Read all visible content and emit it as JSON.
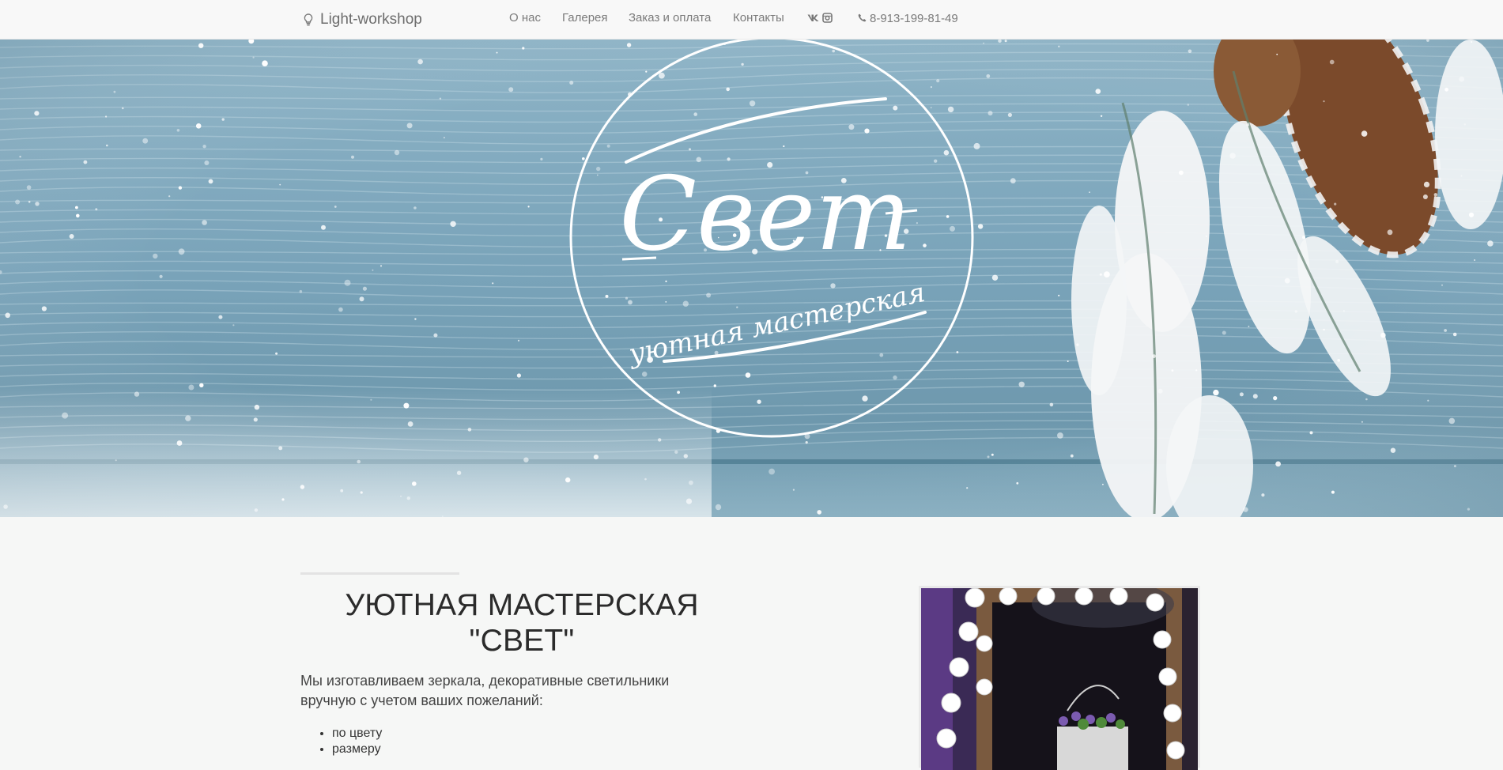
{
  "navbar": {
    "brand": "Light-workshop",
    "brand_icon": "lightbulb-icon",
    "links": [
      "О нас",
      "Галерея",
      "Заказ и оплата",
      "Контакты"
    ],
    "social_icons": [
      "vk-icon",
      "instagram-icon"
    ],
    "phone": "8-913-199-81-49",
    "phone_icon": "phone-icon"
  },
  "hero": {
    "logo_title": "Свет",
    "logo_subtitle": "уютная мастерская"
  },
  "about": {
    "title": "УЮТНАЯ МАСТЕРСКАЯ \"СВЕТ\"",
    "text": "Мы изготавливаем зеркала, декоративные светильники вручную с учетом ваших пожеланий:",
    "features": [
      "по цвету",
      "размеру"
    ]
  },
  "colors": {
    "navbar_bg": "#f8f8f8",
    "page_bg": "#f6f7f6",
    "hero_wood": "#7fa8bd"
  }
}
